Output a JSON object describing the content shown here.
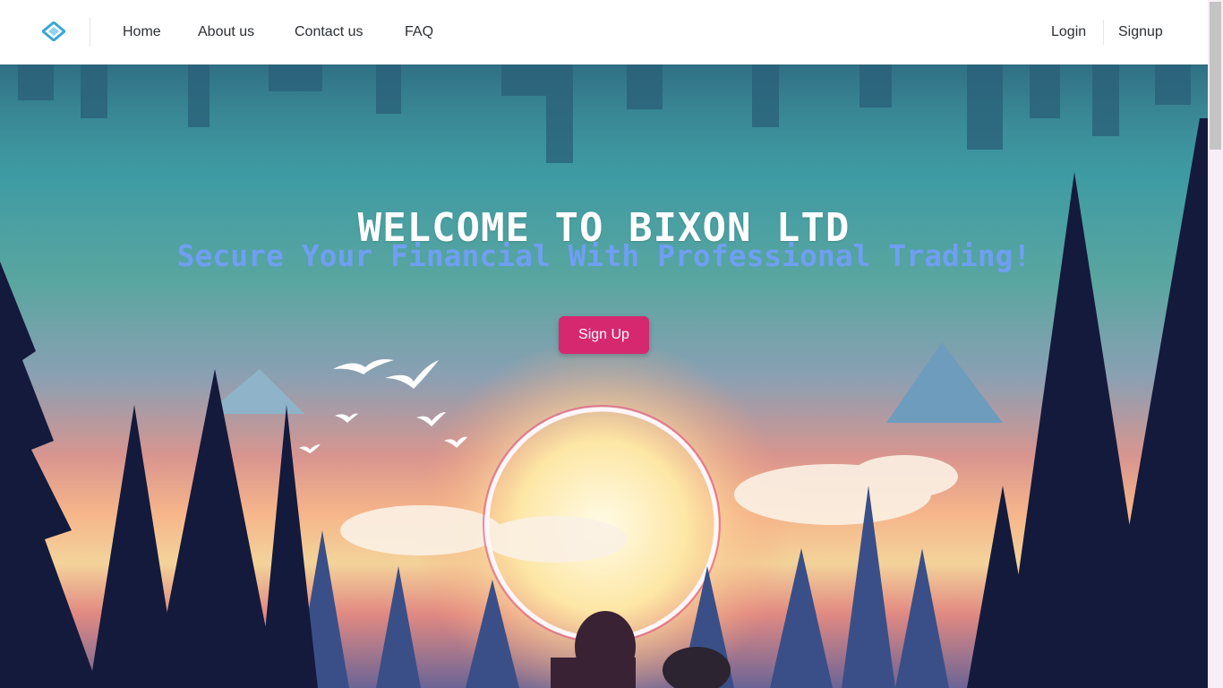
{
  "nav": {
    "logo_icon": "diamond-logo-icon",
    "links": [
      {
        "label": "Home"
      },
      {
        "label": "About us"
      },
      {
        "label": "Contact us"
      },
      {
        "label": "FAQ"
      }
    ],
    "login": "Login",
    "signup": "Signup"
  },
  "hero": {
    "title": "WELCOME TO BIXON LTD",
    "subtitle": "Secure Your Financial With Professional Trading!",
    "cta_label": "Sign Up"
  },
  "colors": {
    "accent": "#d6286f",
    "subtitle": "#6f9ff3",
    "logo": "#3aa6d6"
  }
}
